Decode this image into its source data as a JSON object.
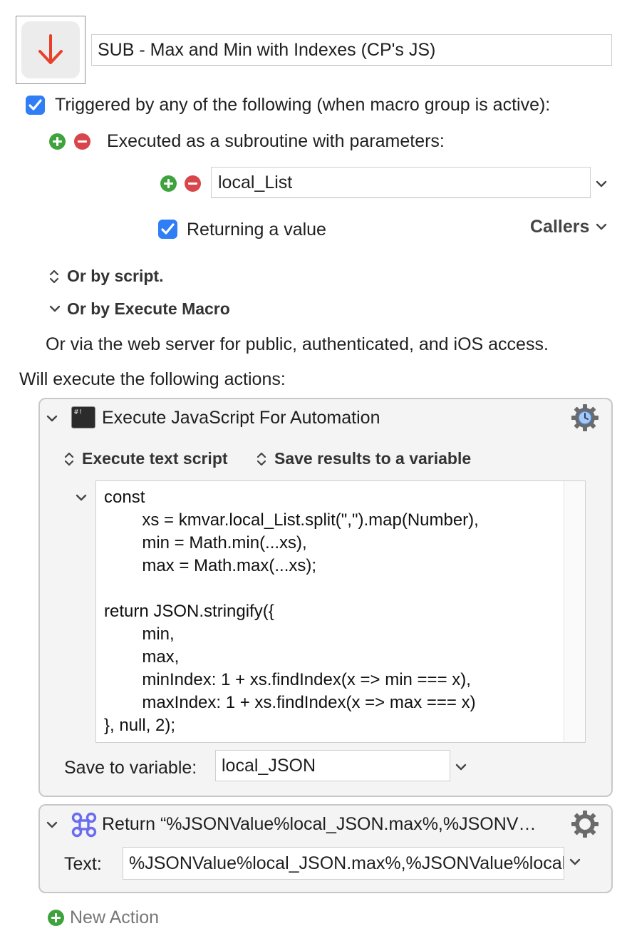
{
  "macro": {
    "name": "SUB - Max and Min with Indexes (CP's JS)",
    "icon": "red-down-arrow-icon"
  },
  "trigger": {
    "checked": true,
    "label": "Triggered by any of the following (when macro group is active):",
    "subroutine_label": "Executed as a subroutine with parameters:",
    "parameter_value": "local_List",
    "returning_checked": true,
    "returning_label": "Returning a value",
    "callers_label": "Callers",
    "or_by_script": "Or by script.",
    "or_by_execute_macro": "Or by Execute Macro",
    "web_server_text": "Or via the web server for public, authenticated, and iOS access."
  },
  "actions_heading": "Will execute the following actions:",
  "actions": [
    {
      "title": "Execute JavaScript For Automation",
      "icon": "terminal-icon",
      "option_1": "Execute text script",
      "option_2": "Save results to a variable",
      "script_lines": [
        "const",
        "        xs = kmvar.local_List.split(\",\").map(Number),",
        "        min = Math.min(...xs),",
        "        max = Math.max(...xs);",
        "",
        "return JSON.stringify({",
        "        min,",
        "        max,",
        "        minIndex: 1 + xs.findIndex(x => min === x),",
        "        maxIndex: 1 + xs.findIndex(x => max === x)",
        "}, null, 2);"
      ],
      "save_to_label": "Save to variable:",
      "save_to_value": "local_JSON"
    },
    {
      "title": "Return “%JSONValue%local_JSON.max%,%JSONV…",
      "icon": "command-icon",
      "text_label": "Text:",
      "text_value": "%JSONValue%local_JSON.max%,%JSONValue%local_JSON.maxIndex%"
    }
  ],
  "new_action_label": "New Action",
  "colors": {
    "accent_blue": "#2f7ef6",
    "plus_green": "#3fa33d",
    "minus_red": "#d8454a",
    "arrow_red": "#e8402a",
    "command_purple": "#6a6cf0"
  }
}
